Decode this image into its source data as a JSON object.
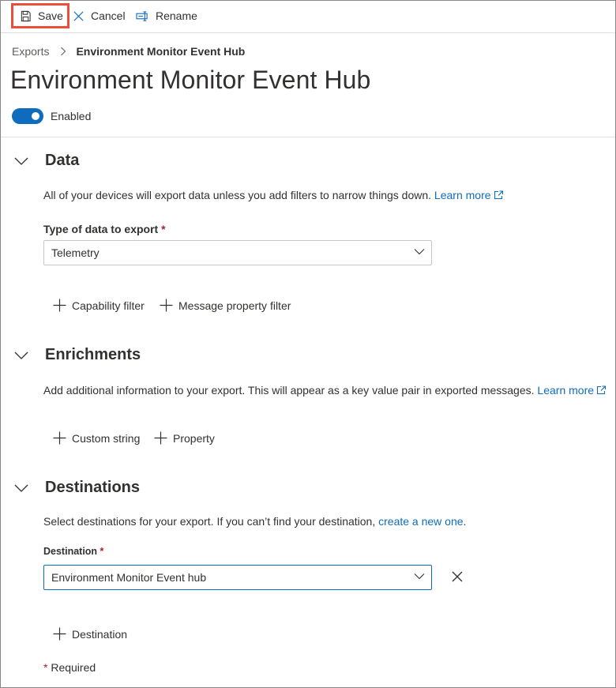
{
  "toolbar": {
    "save_label": "Save",
    "cancel_label": "Cancel",
    "rename_label": "Rename"
  },
  "breadcrumb": {
    "parent": "Exports",
    "current": "Environment Monitor Event Hub"
  },
  "page": {
    "title": "Environment Monitor Event Hub",
    "toggle_label": "Enabled",
    "toggle_on": true
  },
  "data_section": {
    "heading": "Data",
    "description": "All of your devices will export data unless you add filters to narrow things down. ",
    "learn_more": "Learn more",
    "type_label": "Type of data to export",
    "required_mark": "*",
    "type_value": "Telemetry",
    "capability_filter": "Capability filter",
    "message_property_filter": "Message property filter"
  },
  "enrichments_section": {
    "heading": "Enrichments",
    "description": "Add additional information to your export. This will appear as a key value pair in exported messages. ",
    "learn_more": "Learn more",
    "custom_string": "Custom string",
    "property": "Property"
  },
  "destinations_section": {
    "heading": "Destinations",
    "description": "Select destinations for your export. If you can’t find your destination, ",
    "create_link": "create a new one",
    "description_end": ".",
    "destination_label": "Destination",
    "required_mark": "*",
    "destination_value": "Environment Monitor Event hub",
    "add_destination": "Destination"
  },
  "footer": {
    "required_mark": "*",
    "required_text": " Required"
  },
  "colors": {
    "accent": "#0f6cbd",
    "highlight_border": "#e8503a",
    "required": "#a4262c"
  }
}
